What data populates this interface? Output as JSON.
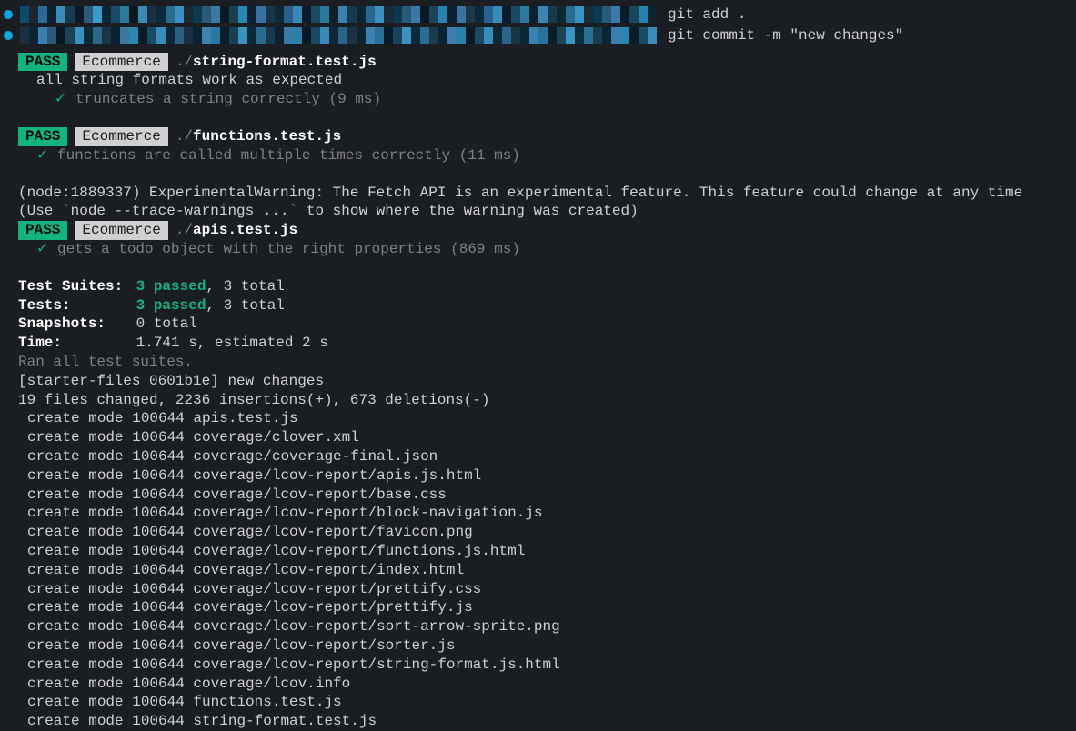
{
  "prompts": [
    {
      "command": "git add ."
    },
    {
      "command": "git commit -m \"new changes\""
    }
  ],
  "tests": [
    {
      "status": "PASS",
      "tag": "Ecommerce",
      "path_prefix": "./",
      "file": "string-format.test.js",
      "describe": "all string formats work as expected",
      "checks": [
        {
          "text": "truncates a string correctly (9 ms)"
        }
      ]
    },
    {
      "status": "PASS",
      "tag": "Ecommerce",
      "path_prefix": "./",
      "file": "functions.test.js",
      "checks": [
        {
          "text": "functions are called multiple times correctly (11 ms)"
        }
      ]
    }
  ],
  "warning_lines": [
    "(node:1889337) ExperimentalWarning: The Fetch API is an experimental feature. This feature could change at any time",
    "(Use `node --trace-warnings ...` to show where the warning was created)"
  ],
  "test3": {
    "status": "PASS",
    "tag": "Ecommerce",
    "path_prefix": "./",
    "file": "apis.test.js",
    "checks": [
      {
        "text": "gets a todo object with the right properties (869 ms)"
      }
    ]
  },
  "summary": {
    "suites_label": "Test Suites:",
    "suites_passed": "3 passed",
    "suites_total": ", 3 total",
    "tests_label": "Tests:",
    "tests_passed": "3 passed",
    "tests_total": ", 3 total",
    "snapshots_label": "Snapshots:",
    "snapshots_value": "0 total",
    "time_label": "Time:",
    "time_value": "1.741 s, estimated 2 s"
  },
  "ran_line": "Ran all test suites.",
  "commit_header": "[starter-files 0601b1e] new changes",
  "commit_stats": " 19 files changed, 2236 insertions(+), 673 deletions(-)",
  "created_files": [
    "create mode 100644 apis.test.js",
    "create mode 100644 coverage/clover.xml",
    "create mode 100644 coverage/coverage-final.json",
    "create mode 100644 coverage/lcov-report/apis.js.html",
    "create mode 100644 coverage/lcov-report/base.css",
    "create mode 100644 coverage/lcov-report/block-navigation.js",
    "create mode 100644 coverage/lcov-report/favicon.png",
    "create mode 100644 coverage/lcov-report/functions.js.html",
    "create mode 100644 coverage/lcov-report/index.html",
    "create mode 100644 coverage/lcov-report/prettify.css",
    "create mode 100644 coverage/lcov-report/prettify.js",
    "create mode 100644 coverage/lcov-report/sort-arrow-sprite.png",
    "create mode 100644 coverage/lcov-report/sorter.js",
    "create mode 100644 coverage/lcov-report/string-format.js.html",
    "create mode 100644 coverage/lcov.info",
    "create mode 100644 functions.test.js",
    "create mode 100644 string-format.test.js"
  ],
  "pixel_colors_1": [
    "#0a4a6a",
    "#1a2833",
    "#2a6a9a",
    "#0a2030",
    "#3a8aba",
    "#1a3a50",
    "#0a1a28",
    "#2a5a7a",
    "#3a9aca",
    "#0a2838",
    "#1a4a68",
    "#2a7a9a",
    "#0a1820",
    "#3a8ab8",
    "#1a3040",
    "#0a2a3a",
    "#2a6a8a",
    "#3a90c0",
    "#1a2830",
    "#0a3a50",
    "#2a5a78",
    "#3a7aa0",
    "#0a1a25",
    "#1a4050",
    "#2a88b0",
    "#0a2030",
    "#3a70a0",
    "#1a3545",
    "#0a2838",
    "#2a6088",
    "#3a88b8",
    "#0a1a28",
    "#1a4a60",
    "#2a78a0",
    "#0a2028",
    "#3a80b0",
    "#1a3848",
    "#0a2535",
    "#2a6890",
    "#3a90c0",
    "#1a2a38",
    "#0a3850",
    "#2a5878",
    "#3a78a8",
    "#0a1825",
    "#1a4258",
    "#2a80b0",
    "#0a2230",
    "#3a72a2",
    "#1a3848",
    "#0a2a3a",
    "#2a6292",
    "#3a8ab8",
    "#0a1c2a",
    "#1a4862",
    "#2a7aa2",
    "#0a2230",
    "#3a82b2",
    "#1a3a4a",
    "#0a2838",
    "#2a6a92",
    "#3a92c2",
    "#1a2c3a",
    "#0a3a52",
    "#2a5a7a",
    "#3a7aaa",
    "#0a1a28",
    "#1a4458",
    "#2a82b2",
    "#0a2432"
  ],
  "pixel_colors_2": [
    "#1a3040",
    "#0a2535",
    "#3a80b0",
    "#2a5a78",
    "#0a1822",
    "#1a4258",
    "#3a90c0",
    "#0a2a38",
    "#2a6888",
    "#1a3545",
    "#0a2030",
    "#3a78a0",
    "#2a88b0",
    "#0a1a25",
    "#1a4a62",
    "#3a8ab8",
    "#0a2838",
    "#2a6082",
    "#1a3042",
    "#0a2232",
    "#3a82b0",
    "#2a78a0",
    "#0a1c28",
    "#1a4050",
    "#3a92c0",
    "#0a2a3a",
    "#2a6a90",
    "#1a3848",
    "#0a2030",
    "#3a7aa8",
    "#2a80a8",
    "#0a1825",
    "#1a4860",
    "#3a88b8",
    "#0a2838",
    "#2a6288",
    "#1a3242",
    "#0a2432",
    "#3a80b0",
    "#2a7098",
    "#0a1a28",
    "#1a4258",
    "#3a92c2",
    "#0a2c3a",
    "#2a6c92",
    "#1a3a4a",
    "#0a2232",
    "#3a7cac",
    "#2a82aa",
    "#0a1a28",
    "#1a4a62",
    "#3a8abc",
    "#0a2a3a",
    "#2a648a",
    "#1a3444",
    "#0a2634",
    "#3a82b2",
    "#2a729a",
    "#0a1c2a",
    "#1a4458",
    "#3a94c4",
    "#0a2e3c",
    "#2a6e94",
    "#1a3c4c",
    "#0a2434",
    "#3a7eae",
    "#2a84ac",
    "#0a1c2a",
    "#1a4c64",
    "#3a8cbe"
  ]
}
